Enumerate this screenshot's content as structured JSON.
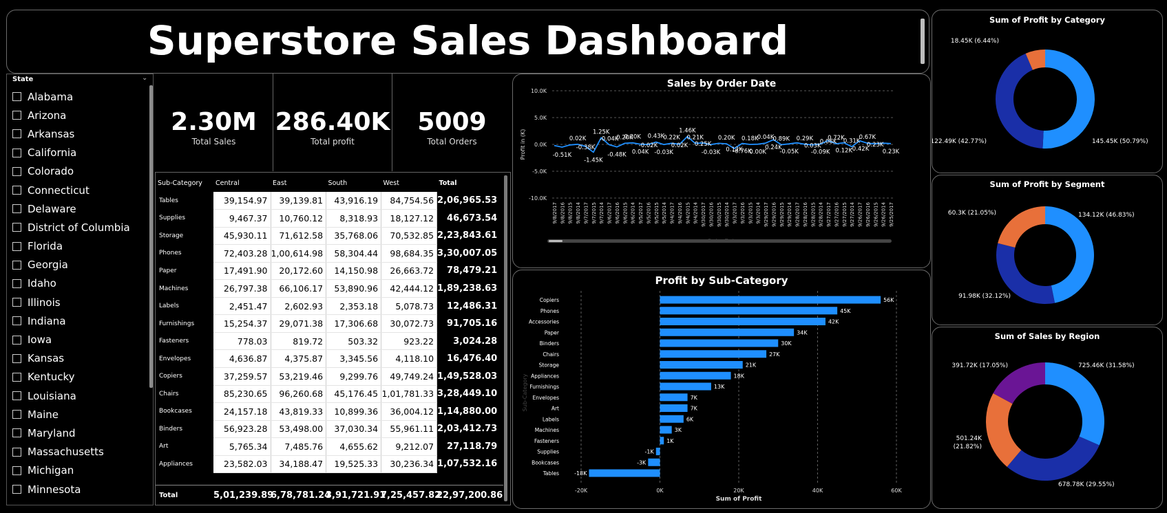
{
  "header": {
    "title": "Superstore Sales Dashboard"
  },
  "slicer": {
    "title": "State",
    "states": [
      "Alabama",
      "Arizona",
      "Arkansas",
      "California",
      "Colorado",
      "Connecticut",
      "Delaware",
      "District of Columbia",
      "Florida",
      "Georgia",
      "Idaho",
      "Illinois",
      "Indiana",
      "Iowa",
      "Kansas",
      "Kentucky",
      "Louisiana",
      "Maine",
      "Maryland",
      "Massachusetts",
      "Michigan",
      "Minnesota"
    ]
  },
  "kpis": [
    {
      "value": "2.30M",
      "label": "Total Sales"
    },
    {
      "value": "286.40K",
      "label": "Total profit"
    },
    {
      "value": "5009",
      "label": "Total Orders"
    }
  ],
  "matrix": {
    "headers": [
      "Sub-Category",
      "Central",
      "East",
      "South",
      "West",
      "Total"
    ],
    "rows": [
      [
        "Tables",
        "39,154.97",
        "39,139.81",
        "43,916.19",
        "84,754.56",
        "2,06,965.53"
      ],
      [
        "Supplies",
        "9,467.37",
        "10,760.12",
        "8,318.93",
        "18,127.12",
        "46,673.54"
      ],
      [
        "Storage",
        "45,930.11",
        "71,612.58",
        "35,768.06",
        "70,532.85",
        "2,23,843.61"
      ],
      [
        "Phones",
        "72,403.28",
        "1,00,614.98",
        "58,304.44",
        "98,684.35",
        "3,30,007.05"
      ],
      [
        "Paper",
        "17,491.90",
        "20,172.60",
        "14,150.98",
        "26,663.72",
        "78,479.21"
      ],
      [
        "Machines",
        "26,797.38",
        "66,106.17",
        "53,890.96",
        "42,444.12",
        "1,89,238.63"
      ],
      [
        "Labels",
        "2,451.47",
        "2,602.93",
        "2,353.18",
        "5,078.73",
        "12,486.31"
      ],
      [
        "Furnishings",
        "15,254.37",
        "29,071.38",
        "17,306.68",
        "30,072.73",
        "91,705.16"
      ],
      [
        "Fasteners",
        "778.03",
        "819.72",
        "503.32",
        "923.22",
        "3,024.28"
      ],
      [
        "Envelopes",
        "4,636.87",
        "4,375.87",
        "3,345.56",
        "4,118.10",
        "16,476.40"
      ],
      [
        "Copiers",
        "37,259.57",
        "53,219.46",
        "9,299.76",
        "49,749.24",
        "1,49,528.03"
      ],
      [
        "Chairs",
        "85,230.65",
        "96,260.68",
        "45,176.45",
        "1,01,781.33",
        "3,28,449.10"
      ],
      [
        "Bookcases",
        "24,157.18",
        "43,819.33",
        "10,899.36",
        "36,004.12",
        "1,14,880.00"
      ],
      [
        "Binders",
        "56,923.28",
        "53,498.00",
        "37,030.34",
        "55,961.11",
        "2,03,412.73"
      ],
      [
        "Art",
        "5,765.34",
        "7,485.76",
        "4,655.62",
        "9,212.07",
        "27,118.79"
      ],
      [
        "Appliances",
        "23,582.03",
        "34,188.47",
        "19,525.33",
        "30,236.34",
        "1,07,532.16"
      ]
    ],
    "total_row": [
      "Total",
      "5,01,239.89",
      "6,78,781.24",
      "3,91,721.91",
      "7,25,457.82",
      "22,97,200.86"
    ]
  },
  "line_chart": {
    "title": "Sales by Order Date",
    "ylabel": "Profit in (K)",
    "xlabel": "Order Date",
    "yticks": [
      "10.0K",
      "5.0K",
      "0.0K",
      "-5.0K",
      "-10.0K"
    ],
    "x_dates": [
      "9/8/2017",
      "9/8/2016",
      "9/8/2015",
      "9/8/2014",
      "9/7/2017",
      "9/7/2015",
      "9/7/2014",
      "9/6/2017",
      "9/6/2016",
      "9/6/2015",
      "9/6/2014",
      "9/5/2017",
      "9/5/2016",
      "9/5/2015",
      "9/5/2014",
      "9/4/2017",
      "9/4/2016",
      "9/4/2015",
      "9/4/2014",
      "9/30/2017",
      "9/30/2016",
      "9/30/2015",
      "9/30/2014",
      "9/3/2017",
      "9/3/2016",
      "9/3/2015",
      "9/3/2014",
      "9/29/2017",
      "9/29/2016",
      "9/29/2015",
      "9/29/2014",
      "9/28/2017",
      "9/28/2016",
      "9/28/2015",
      "9/28/2014",
      "9/27/2017",
      "9/27/2016",
      "9/27/2015",
      "9/27/2014",
      "9/26/2017",
      "9/26/2016",
      "9/26/2015",
      "9/26/2014",
      "9/25/2017"
    ],
    "values": [
      -0.2,
      -0.51,
      -0.1,
      0.02,
      -0.38,
      -1.45,
      1.25,
      -0.04,
      -0.48,
      0.2,
      0.3,
      0.04,
      -0.02,
      0.43,
      -0.03,
      0.22,
      0.02,
      1.46,
      0.21,
      0.25,
      -0.03,
      0.2,
      0.12,
      -0.76,
      0.18,
      0.0,
      0.04,
      0.24,
      0.89,
      -0.05,
      0.1,
      0.29,
      0.03,
      -0.09,
      0.06,
      0.72,
      0.12,
      0.31,
      -0.42,
      0.67,
      0.23,
      0.1,
      0.23,
      0.15
    ],
    "labels": [
      {
        "i": 1,
        "text": "-0.51K",
        "pos": "below"
      },
      {
        "i": 3,
        "text": "0.02K",
        "pos": "above"
      },
      {
        "i": 4,
        "text": "-0.38K",
        "pos": "mid"
      },
      {
        "i": 5,
        "text": "-1.45K",
        "pos": "below"
      },
      {
        "i": 6,
        "text": "1.25K",
        "pos": "above"
      },
      {
        "i": 7,
        "text": "-0.04K",
        "pos": "above"
      },
      {
        "i": 8,
        "text": "-0.48K",
        "pos": "below"
      },
      {
        "i": 9,
        "text": "0.20K",
        "pos": "above"
      },
      {
        "i": 10,
        "text": "0.30K",
        "pos": "above"
      },
      {
        "i": 11,
        "text": "0.04K",
        "pos": "below"
      },
      {
        "i": 13,
        "text": "0.43K",
        "pos": "above"
      },
      {
        "i": 12,
        "text": "-0.02K",
        "pos": "mid"
      },
      {
        "i": 14,
        "text": "-0.03K",
        "pos": "below"
      },
      {
        "i": 15,
        "text": "0.22K",
        "pos": "above"
      },
      {
        "i": 16,
        "text": "0.02K",
        "pos": "mid"
      },
      {
        "i": 17,
        "text": "1.46K",
        "pos": "above"
      },
      {
        "i": 18,
        "text": "0.21K",
        "pos": "above"
      },
      {
        "i": 19,
        "text": "0.25K",
        "pos": "mid"
      },
      {
        "i": 20,
        "text": "-0.03K",
        "pos": "below"
      },
      {
        "i": 22,
        "text": "0.20K",
        "pos": "above"
      },
      {
        "i": 23,
        "text": "0.12K",
        "pos": "mid"
      },
      {
        "i": 24,
        "text": "-0.76K",
        "pos": "below"
      },
      {
        "i": 25,
        "text": "0.18K",
        "pos": "above"
      },
      {
        "i": 27,
        "text": "0.04K",
        "pos": "above"
      },
      {
        "i": 26,
        "text": "0.00K",
        "pos": "below"
      },
      {
        "i": 28,
        "text": "0.24K",
        "pos": "below"
      },
      {
        "i": 29,
        "text": "0.89K",
        "pos": "above"
      },
      {
        "i": 30,
        "text": "-0.05K",
        "pos": "below"
      },
      {
        "i": 32,
        "text": "0.29K",
        "pos": "above"
      },
      {
        "i": 33,
        "text": "0.03K",
        "pos": "mid"
      },
      {
        "i": 34,
        "text": "-0.09K",
        "pos": "below"
      },
      {
        "i": 35,
        "text": "0.06K",
        "pos": "mid"
      },
      {
        "i": 36,
        "text": "0.72K",
        "pos": "above"
      },
      {
        "i": 37,
        "text": "0.12K",
        "pos": "below"
      },
      {
        "i": 38,
        "text": "0.31K",
        "pos": "above"
      },
      {
        "i": 39,
        "text": "-0.42K",
        "pos": "below"
      },
      {
        "i": 40,
        "text": "0.67K",
        "pos": "above"
      },
      {
        "i": 41,
        "text": "0.23K",
        "pos": "mid"
      },
      {
        "i": 43,
        "text": "0.23K",
        "pos": "below"
      }
    ],
    "color": "#1f8fff"
  },
  "chart_data": [
    {
      "type": "bar",
      "title": "Profit by Sub-Category",
      "xlabel": "Sum of Profit",
      "ylabel": "Sub-Category",
      "orientation": "horizontal",
      "categories": [
        "Copiers",
        "Phones",
        "Accessories",
        "Paper",
        "Binders",
        "Chairs",
        "Storage",
        "Appliances",
        "Furnishings",
        "Envelopes",
        "Art",
        "Labels",
        "Machines",
        "Fasteners",
        "Supplies",
        "Bookcases",
        "Tables"
      ],
      "values": [
        56,
        45,
        42,
        34,
        30,
        27,
        21,
        18,
        13,
        7,
        7,
        6,
        3,
        1,
        -1,
        -3,
        -18
      ],
      "value_labels": [
        "56K",
        "45K",
        "42K",
        "34K",
        "30K",
        "27K",
        "21K",
        "18K",
        "13K",
        "7K",
        "7K",
        "6K",
        "3K",
        "1K",
        "-1K",
        "-3K",
        "-18K"
      ],
      "xticks": [
        "-20K",
        "0K",
        "20K",
        "40K",
        "60K"
      ],
      "xlim": [
        -20,
        60
      ],
      "color": "#1f8fff"
    },
    {
      "type": "pie",
      "title": "Sum of Profit by Category",
      "values": [
        145.45,
        122.49,
        18.45
      ],
      "labels": [
        "145.45K (50.79%)",
        "122.49K (42.77%)",
        "18.45K (6.44%)"
      ],
      "colors": [
        "#1f8fff",
        "#1a2fa8",
        "#e8703a"
      ]
    },
    {
      "type": "pie",
      "title": "Sum of Profit by Segment",
      "values": [
        134.12,
        91.98,
        60.3
      ],
      "labels": [
        "134.12K (46.83%)",
        "91.98K (32.12%)",
        "60.3K (21.05%)"
      ],
      "colors": [
        "#1f8fff",
        "#1a2fa8",
        "#e8703a"
      ]
    },
    {
      "type": "pie",
      "title": "Sum of Sales by Region",
      "values": [
        725.46,
        678.78,
        501.24,
        391.72
      ],
      "labels": [
        "725.46K (31.58%)",
        "678.78K (29.55%)",
        "501.24K (21.82%)",
        "391.72K (17.05%)"
      ],
      "colors": [
        "#1f8fff",
        "#1a2fa8",
        "#e8703a",
        "#6a1595"
      ]
    }
  ]
}
